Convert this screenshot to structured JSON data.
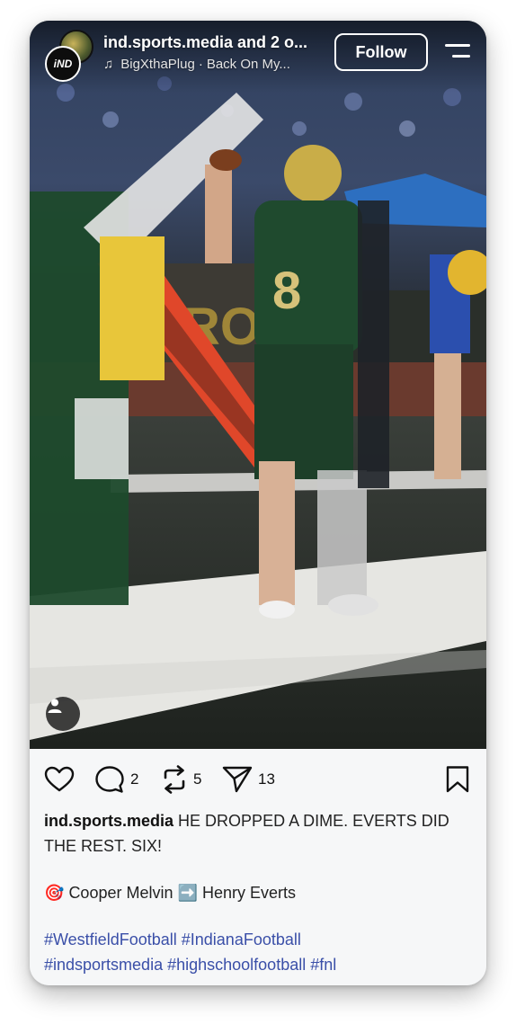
{
  "header": {
    "account_text": "ind.sports.media and 2 o...",
    "audio_artist": "BigXthaPlug",
    "audio_separator": "·",
    "audio_track": "Back On My...",
    "follow_label": "Follow",
    "logo_text": "iND",
    "icons": {
      "music": "music-note-icon",
      "menu": "menu-icon",
      "user_tag": "person-icon"
    }
  },
  "actions": {
    "like": {
      "icon": "heart-icon"
    },
    "comment": {
      "icon": "comment-icon",
      "count": "2"
    },
    "repost": {
      "icon": "repost-icon",
      "count": "5"
    },
    "share": {
      "icon": "send-icon",
      "count": "13"
    },
    "save": {
      "icon": "bookmark-icon"
    }
  },
  "caption": {
    "username": "ind.sports.media",
    "text": "HE DROPPED A DIME. EVERTS DID THE REST. SIX!",
    "line2_emoji": "🎯",
    "line2_name1": "Cooper Melvin",
    "line2_arrow": "➡️",
    "line2_name2": "Henry Everts",
    "hashtags_line1": [
      "#WestfieldFootball",
      "#IndianaFootball"
    ],
    "hashtags_line2": [
      "#indsportsmedia",
      "#highschoolfootball",
      "#fnl"
    ]
  },
  "colors": {
    "hashtag": "#3a4fa8",
    "panel_bg": "#f6f7f8",
    "jersey_green": "#1f4a2e"
  }
}
